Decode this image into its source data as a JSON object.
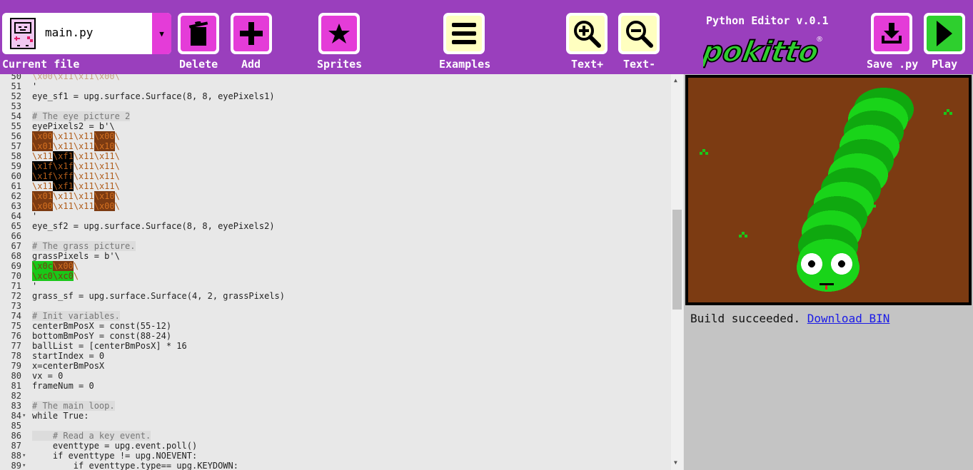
{
  "toolbar": {
    "current_file_label": "Current file",
    "file_name": "main.py",
    "dropdown_glyph": "▼",
    "buttons": {
      "delete": "Delete",
      "add": "Add",
      "sprites": "Sprites",
      "examples": "Examples",
      "text_plus": "Text+",
      "text_minus": "Text-",
      "save": "Save .py",
      "play": "Play"
    },
    "editor_title": "Python Editor v.0.1",
    "brand": "pokitto"
  },
  "colors": {
    "toolbar_bg": "#9a3fbd",
    "button_magenta": "#e43cd8",
    "button_yellow": "#ffffc0",
    "button_green": "#2ecf2e",
    "screen_bg": "#7c3b12",
    "snake_green": "#19d419"
  },
  "icons": [
    "gameboy-icon",
    "trash-icon",
    "plus-icon",
    "star-icon",
    "hamburger-icon",
    "zoom-in-icon",
    "zoom-out-icon",
    "download-icon",
    "play-icon"
  ],
  "editor": {
    "lines": [
      {
        "n": "50",
        "text": "\\x00\\x11\\x11\\x00\\"
      },
      {
        "n": "51",
        "text": "'"
      },
      {
        "n": "52",
        "text": "eye_sf1 = upg.surface.Surface(8, 8, eyePixels1)"
      },
      {
        "n": "53",
        "text": ""
      },
      {
        "n": "54",
        "text": "# The eye picture 2"
      },
      {
        "n": "55",
        "text": "eyePixels2 = b'\\"
      },
      {
        "n": "56",
        "text": "\\x00\\x11\\x11\\x00\\"
      },
      {
        "n": "57",
        "text": "\\x01\\x11\\x11\\x10\\"
      },
      {
        "n": "58",
        "text": "\\x11\\xf1\\x11\\x11\\"
      },
      {
        "n": "59",
        "text": "\\x1f\\x1f\\x11\\x11\\"
      },
      {
        "n": "60",
        "text": "\\x1f\\xff\\x11\\x11\\"
      },
      {
        "n": "61",
        "text": "\\x11\\xf1\\x11\\x11\\"
      },
      {
        "n": "62",
        "text": "\\x01\\x11\\x11\\x10\\"
      },
      {
        "n": "63",
        "text": "\\x00\\x11\\x11\\x00\\"
      },
      {
        "n": "64",
        "text": "'"
      },
      {
        "n": "65",
        "text": "eye_sf2 = upg.surface.Surface(8, 8, eyePixels2)"
      },
      {
        "n": "66",
        "text": ""
      },
      {
        "n": "67",
        "text": "# The grass picture."
      },
      {
        "n": "68",
        "text": "grassPixels = b'\\"
      },
      {
        "n": "69",
        "text": "\\x0c\\x00\\"
      },
      {
        "n": "70",
        "text": "\\xc0\\xc0\\"
      },
      {
        "n": "71",
        "text": "'"
      },
      {
        "n": "72",
        "text": "grass_sf = upg.surface.Surface(4, 2, grassPixels)"
      },
      {
        "n": "73",
        "text": ""
      },
      {
        "n": "74",
        "text": "# Init variables."
      },
      {
        "n": "75",
        "text": "centerBmPosX = const(55-12)"
      },
      {
        "n": "76",
        "text": "bottomBmPosY = const(88-24)"
      },
      {
        "n": "77",
        "text": "ballList = [centerBmPosX] * 16"
      },
      {
        "n": "78",
        "text": "startIndex = 0"
      },
      {
        "n": "79",
        "text": "x=centerBmPosX"
      },
      {
        "n": "80",
        "text": "vx = 0"
      },
      {
        "n": "81",
        "text": "frameNum = 0"
      },
      {
        "n": "82",
        "text": ""
      },
      {
        "n": "83",
        "text": "# The main loop."
      },
      {
        "n": "84",
        "text": "while True:"
      },
      {
        "n": "85",
        "text": ""
      },
      {
        "n": "86",
        "text": "    # Read a key event."
      },
      {
        "n": "87",
        "text": "    eventtype = upg.event.poll()"
      },
      {
        "n": "88",
        "text": "    if eventtype != upg.NOEVENT:"
      },
      {
        "n": "89",
        "text": "        if eventtype.type== upg.KEYDOWN:"
      },
      {
        "n": "90",
        "text": "            if eventtype.key == upg.K_RIGHT:"
      }
    ]
  },
  "status": {
    "message": "Build succeeded.",
    "link": "Download BIN"
  }
}
